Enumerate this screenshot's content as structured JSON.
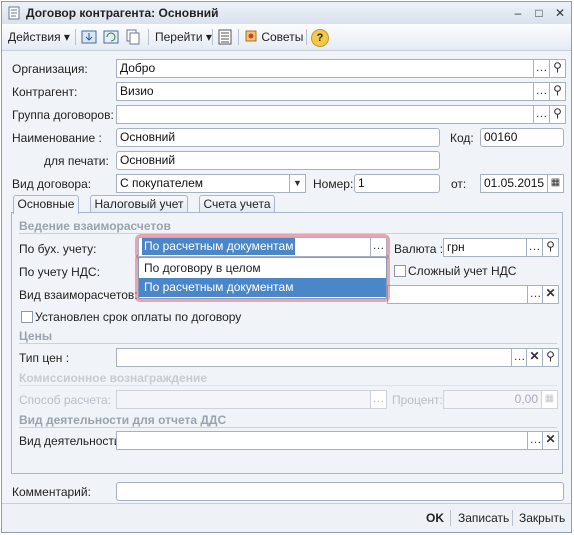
{
  "window": {
    "title": "Договор контрагента: Основний",
    "minimize": "–",
    "maximize": "□",
    "close": "✕"
  },
  "toolbar": {
    "actions": "Действия",
    "goto": "Перейти",
    "tips": "Советы",
    "help": "?"
  },
  "form": {
    "org_label": "Организация:",
    "org_value": "Добро",
    "contractor_label": "Контрагент:",
    "contractor_value": "Визио",
    "group_label": "Группа договоров:",
    "group_value": "",
    "name_label": "Наименование :",
    "name_value": "Основний",
    "code_label": "Код:",
    "code_value": "00160",
    "print_label": "для печати:",
    "print_value": "Основний",
    "type_label": "Вид договора:",
    "type_value": "С покупателем",
    "number_label": "Номер:",
    "number_value": "1",
    "date_label": "от:",
    "date_value": "01.05.2015"
  },
  "tabs": [
    "Основные",
    "Налоговый учет",
    "Счета учета"
  ],
  "panel": {
    "settlement_section": "Ведение взаиморасчетов",
    "acc_label": "По бух. учету:",
    "acc_value": "По расчетным документам",
    "currency_label": "Валюта :",
    "currency_value": "грн",
    "vat_label": "По учету НДС:",
    "complex_vat_label": "Сложный  учет НДС",
    "mutual_label": "Вид взаиморасчетов:",
    "mutual_value": "",
    "due_label": "Установлен срок оплаты по договору",
    "prices_section": "Цены",
    "price_type_label": "Тип цен :",
    "price_type_value": "",
    "commission_section": "Комиссионное вознаграждение",
    "calc_label": "Способ расчета:",
    "calc_value": "",
    "percent_label": "Процент:",
    "percent_value": "0,00",
    "dds_section": "Вид деятельности для отчета ДДС",
    "activity_label": "Вид деятельности:",
    "activity_value": ""
  },
  "dropdown": {
    "options": [
      "По договору в целом",
      "По расчетным документам"
    ],
    "selected_index": 1
  },
  "comment_label": "Комментарий:",
  "comment_value": "",
  "status": {
    "ok": "OK",
    "save": "Записать",
    "close": "Закрыть"
  },
  "colors": {
    "accent": "#4a86c8",
    "highlight": "#dc465a"
  }
}
